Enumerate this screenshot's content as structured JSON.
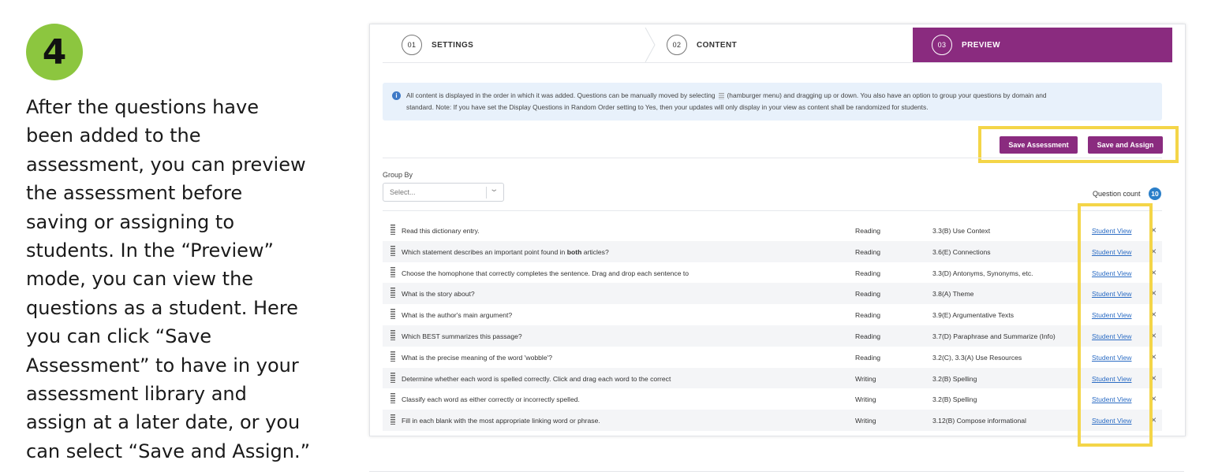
{
  "step_badge": "4",
  "instructions": [
    "After the questions have",
    "been added to the",
    "assessment, you can preview",
    "the assessment before",
    "saving or assigning to",
    "students. In the “Preview”",
    "mode, you can view the",
    "questions as a student. Here",
    "you can click “Save",
    "Assessment” to have in your",
    "assessment library and",
    "assign at a later date, or you",
    "can select “Save and Assign.”"
  ],
  "stepper": {
    "steps": [
      {
        "num": "01",
        "label": "SETTINGS"
      },
      {
        "num": "02",
        "label": "CONTENT"
      },
      {
        "num": "03",
        "label": "PREVIEW"
      }
    ],
    "active_color": "#8a2b7f"
  },
  "info": {
    "icon": "info-icon",
    "text_part1": "All content is displayed in the order in which it was added. Questions can be manually moved by selecting",
    "text_part2": "(hamburger menu) and dragging up or down. You also have an option to group your questions by domain and",
    "text_line2": "standard. Note: If you have set the Display Questions in Random Order setting to Yes, then your updates will only display in your view as content shall be randomized for students."
  },
  "actions": {
    "save_assessment": "Save Assessment",
    "save_and_assign": "Save and Assign"
  },
  "group_by": {
    "label": "Group By",
    "placeholder": "Select..."
  },
  "question_count": {
    "label": "Question count",
    "value": "10"
  },
  "questions": [
    {
      "text": "Read this dictionary entry.",
      "domain": "Reading",
      "standard": "3.3(B) Use Context",
      "link": "Student View"
    },
    {
      "text_before": "Which statement describes an important point found in ",
      "text_bold": "both",
      "text_after": " articles?",
      "domain": "Reading",
      "standard": "3.6(E) Connections",
      "link": "Student View"
    },
    {
      "text": "Choose the homophone that correctly completes the sentence. Drag and drop each sentence to",
      "domain": "Reading",
      "standard": "3.3(D) Antonyms, Synonyms, etc.",
      "link": "Student View"
    },
    {
      "text": "What is the story about?",
      "domain": "Reading",
      "standard": "3.8(A) Theme",
      "link": "Student View"
    },
    {
      "text": "What is the author's main argument?",
      "domain": "Reading",
      "standard": "3.9(E) Argumentative Texts",
      "link": "Student View"
    },
    {
      "text": "Which BEST summarizes this passage?",
      "domain": "Reading",
      "standard": "3.7(D) Paraphrase and Summarize (Info)",
      "link": "Student View"
    },
    {
      "text": "What is the precise meaning of the word 'wobble'?",
      "domain": "Reading",
      "standard": "3.2(C), 3.3(A) Use Resources",
      "link": "Student View"
    },
    {
      "text": "Determine whether each word is spelled correctly. Click and drag each word to the correct",
      "domain": "Writing",
      "standard": "3.2(B) Spelling",
      "link": "Student View"
    },
    {
      "text": "Classify each word as either correctly or incorrectly spelled.",
      "domain": "Writing",
      "standard": "3.2(B) Spelling",
      "link": "Student View"
    },
    {
      "text": "Fill in each blank with the most appropriate linking word or phrase.",
      "domain": "Writing",
      "standard": "3.12(B) Compose informational",
      "link": "Student View"
    }
  ],
  "colors": {
    "badge": "#8cc63f",
    "primary": "#8a2b7f",
    "highlight": "#f4d548",
    "link": "#2b6cc4",
    "count_badge": "#2b7fc9"
  }
}
